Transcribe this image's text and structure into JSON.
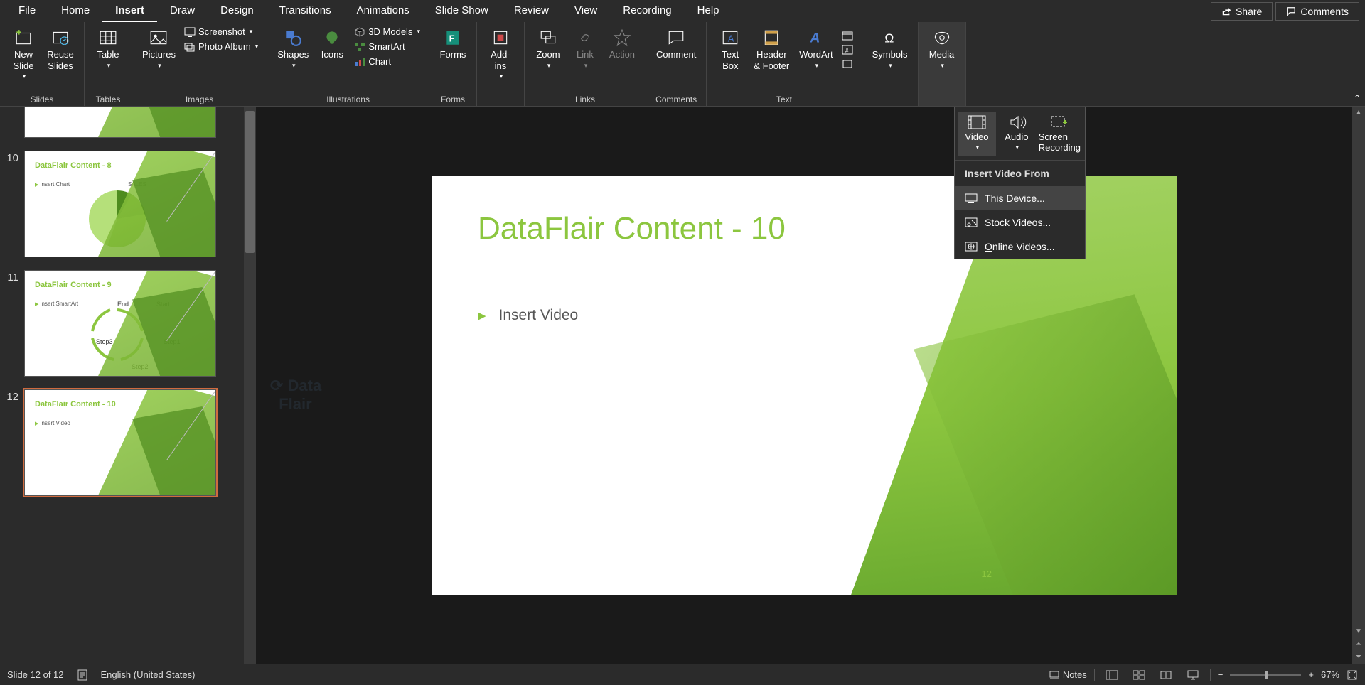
{
  "menu": {
    "tabs": [
      "File",
      "Home",
      "Insert",
      "Draw",
      "Design",
      "Transitions",
      "Animations",
      "Slide Show",
      "Review",
      "View",
      "Recording",
      "Help"
    ],
    "active": "Insert",
    "share": "Share",
    "comments": "Comments"
  },
  "ribbon": {
    "groups": {
      "slides": "Slides",
      "tables": "Tables",
      "images": "Images",
      "illustrations": "Illustrations",
      "forms": "Forms",
      "links": "Links",
      "comments": "Comments",
      "text": "Text",
      "symbols_btn": "Symbols",
      "media_btn": "Media"
    },
    "new_slide": "New\nSlide",
    "reuse_slides": "Reuse\nSlides",
    "table": "Table",
    "pictures": "Pictures",
    "screenshot": "Screenshot",
    "photo_album": "Photo Album",
    "shapes": "Shapes",
    "icons": "Icons",
    "models3d": "3D Models",
    "smartart": "SmartArt",
    "chart": "Chart",
    "forms_btn": "Forms",
    "addins": "Add-\nins",
    "zoom": "Zoom",
    "link": "Link",
    "action": "Action",
    "comment": "Comment",
    "text_box": "Text\nBox",
    "header_footer": "Header\n& Footer",
    "wordart": "WordArt"
  },
  "thumbs": {
    "t9_partial": {
      "num": ""
    },
    "t10": {
      "num": "10",
      "title": "DataFlair Content - 8",
      "bullet": "Insert Chart",
      "sales": "SALES"
    },
    "t11": {
      "num": "11",
      "title": "DataFlair Content - 9",
      "bullet": "Insert SmartArt",
      "labels": {
        "start": "Start",
        "step1": "Step1",
        "step2": "Step2",
        "step3": "Step3",
        "end": "End"
      }
    },
    "t12": {
      "num": "12",
      "title": "DataFlair Content - 10",
      "bullet": "Insert Video"
    }
  },
  "slide": {
    "title": "DataFlair Content - 10",
    "bullet": "Insert Video",
    "page_num": "12"
  },
  "media_menu": {
    "video": "Video",
    "audio": "Audio",
    "screen_rec": "Screen\nRecording",
    "header": "Insert Video From",
    "this_device": "This Device...",
    "stock": "Stock Videos...",
    "online": "Online Videos..."
  },
  "status": {
    "slide_pos": "Slide 12 of 12",
    "lang": "English (United States)",
    "notes": "Notes",
    "zoom": "67%"
  }
}
